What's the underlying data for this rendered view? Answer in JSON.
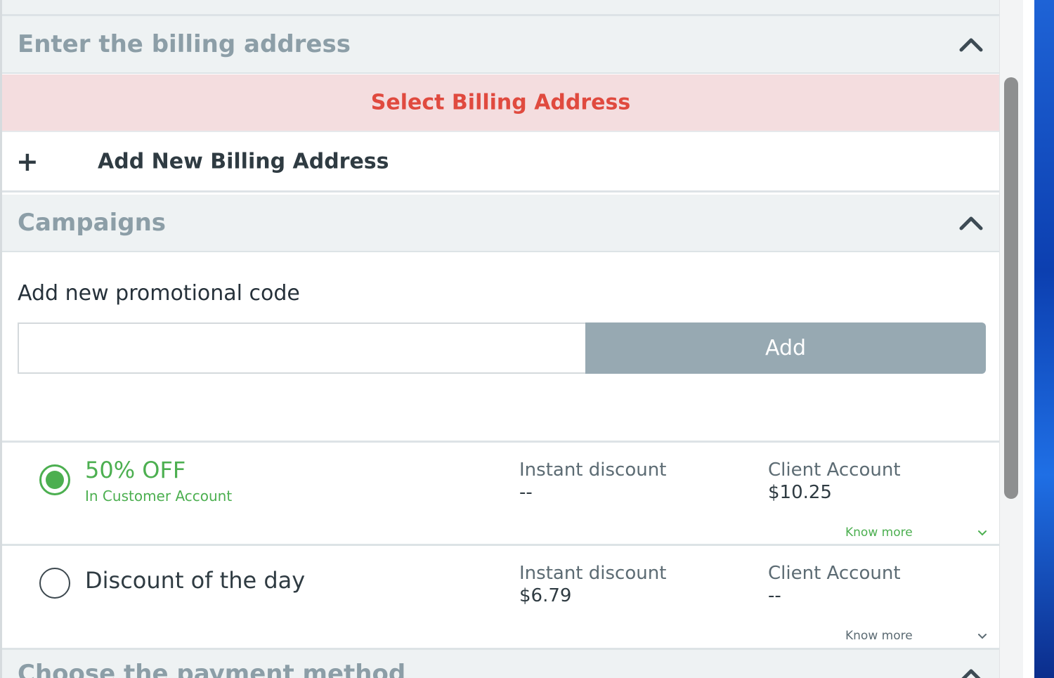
{
  "billing": {
    "title": "Enter the billing address",
    "alert": "Select Billing Address",
    "add_new": "Add New Billing Address",
    "add_icon": "+"
  },
  "campaigns": {
    "title": "Campaigns",
    "promo_label": "Add new promotional code",
    "promo_input_value": "",
    "promo_placeholder": "",
    "add_button": "Add",
    "items": [
      {
        "name": "50% OFF",
        "subtitle": "In Customer Account",
        "instant_label": "Instant discount",
        "instant_value": "--",
        "client_label": "Client Account",
        "client_value": "$10.25",
        "know_more": "Know more",
        "selected": true
      },
      {
        "name": "Discount of the day",
        "subtitle": "",
        "instant_label": "Instant discount",
        "instant_value": "$6.79",
        "client_label": "Client Account",
        "client_value": "--",
        "know_more": "Know more",
        "selected": false
      }
    ]
  },
  "payment": {
    "title": "Choose the payment method"
  },
  "colors": {
    "header_bg": "#eef2f3",
    "alert_bg": "#f4dddf",
    "alert_text": "#e04a3f",
    "accent_green": "#4caf50",
    "button_gray": "#97a9b2"
  },
  "icons": {
    "collapse": "chevron-up-icon",
    "expand": "chevron-down-icon",
    "add": "plus-icon"
  }
}
